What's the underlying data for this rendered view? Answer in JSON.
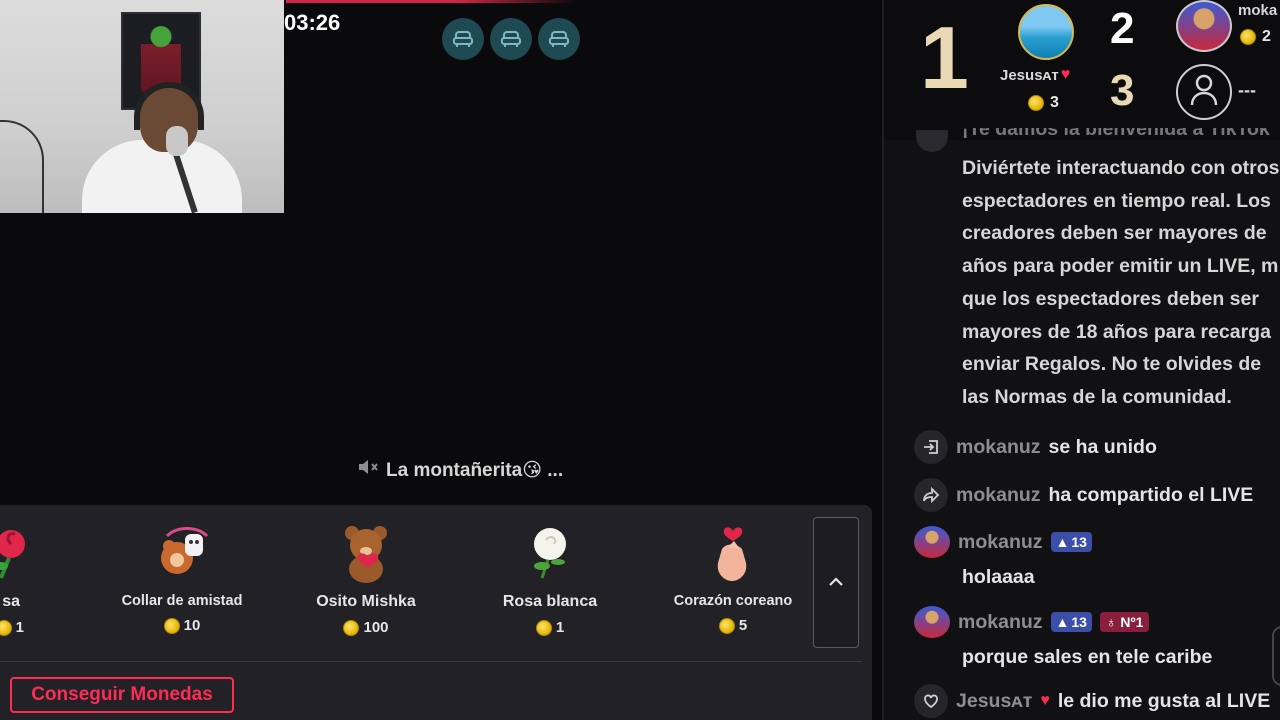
{
  "stream": {
    "timer": "03:26",
    "ticker_text": "La montañerita😘 ...",
    "seats": [
      "seat-icon",
      "seat-icon",
      "seat-icon"
    ]
  },
  "gifts": {
    "items": [
      {
        "name": "sa",
        "price": "1",
        "icon": "rose-icon"
      },
      {
        "name": "Collar de amistad",
        "price": "10",
        "icon": "friendship-necklace-icon"
      },
      {
        "name": "Osito Mishka",
        "price": "100",
        "icon": "teddy-bear-icon"
      },
      {
        "name": "Rosa blanca",
        "price": "1",
        "icon": "white-rose-icon"
      },
      {
        "name": "Corazón coreano",
        "price": "5",
        "icon": "korean-heart-icon"
      }
    ],
    "get_coins_label": "Conseguir Monedas"
  },
  "ranking": {
    "first": {
      "rank": "1",
      "name": "Jesusᴀᴛ",
      "coins": "3"
    },
    "second": {
      "rank": "2",
      "name": "moka",
      "coins": "2"
    },
    "third": {
      "rank": "3",
      "name": "---"
    }
  },
  "chat": {
    "welcome_cut": "¡Te damos la bienvenida a TikTok",
    "welcome_lines": [
      "Diviértete interactuando con otros",
      "espectadores en tiempo real. Los",
      "creadores deben ser mayores de",
      "años para poder emitir un LIVE, m",
      "que los espectadores deben ser",
      "mayores de 18 años para recarga",
      "enviar Regalos. No te olvides de",
      "las Normas de la comunidad."
    ],
    "messages": [
      {
        "user": "mokanuz",
        "text": "se ha unido"
      },
      {
        "user": "mokanuz",
        "text": "ha compartido el LIVE"
      },
      {
        "user": "mokanuz",
        "level": "13",
        "text": "holaaaa"
      },
      {
        "user": "mokanuz",
        "level": "13",
        "fan_badge": "Nº1",
        "text": "porque sales en tele caribe"
      },
      {
        "user": "Jesusᴀᴛ",
        "text": "le dio me gusta al LIVE"
      }
    ]
  },
  "colors": {
    "accent": "#fe2c55",
    "level_badge": "#3b4fa8",
    "seat": "#1f4a52"
  }
}
